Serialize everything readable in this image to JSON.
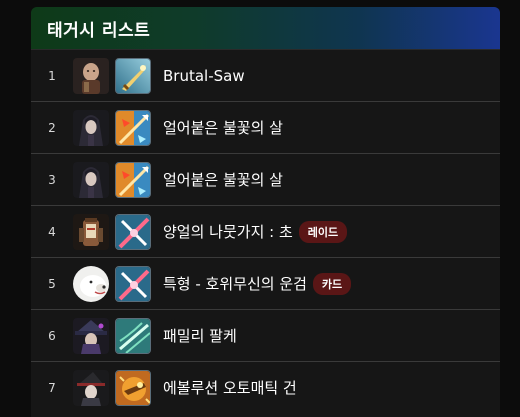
{
  "header": {
    "title": "태거시 리스트"
  },
  "rows": [
    {
      "rank": "1",
      "name": "Brutal-Saw",
      "badge": "",
      "avatar_icon": "bald-warrior-portrait-icon",
      "skill_icon": "golden-sword-skill-icon"
    },
    {
      "rank": "2",
      "name": "얼어붙은 불꽃의 살",
      "badge": "",
      "avatar_icon": "hooded-woman-portrait-icon",
      "skill_icon": "ice-fire-arrow-skill-icon"
    },
    {
      "rank": "3",
      "name": "얼어붙은 불꽃의 살",
      "badge": "",
      "avatar_icon": "hooded-woman-portrait-icon",
      "skill_icon": "ice-fire-arrow-skill-icon"
    },
    {
      "rank": "4",
      "name": "양얼의 나뭇가지 : 초",
      "badge": "레이드",
      "avatar_icon": "lantern-golem-portrait-icon",
      "skill_icon": "crossed-blade-skill-icon"
    },
    {
      "rank": "5",
      "name": "특형 - 호위무신의 운검",
      "badge": "카드",
      "avatar_icon": "white-beast-portrait-icon",
      "skill_icon": "crossed-blade-skill-icon"
    },
    {
      "rank": "6",
      "name": "패밀리 팔케",
      "badge": "",
      "avatar_icon": "hatted-mage-portrait-icon",
      "skill_icon": "wind-slash-skill-icon"
    },
    {
      "rank": "7",
      "name": "에볼루션 오토매틱 건",
      "badge": "",
      "avatar_icon": "witch-portrait-icon",
      "skill_icon": "golden-gun-skill-icon"
    }
  ],
  "colors": {
    "header_start": "#0e3a18",
    "header_end": "#1a3690",
    "badge_bg": "#5a1616",
    "row_bg": "#161616"
  }
}
